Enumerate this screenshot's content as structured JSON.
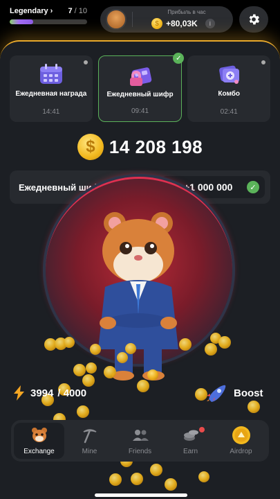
{
  "header": {
    "level_name": "Legendary",
    "level_current": "7",
    "level_total": "/ 10",
    "level_progress": 0.3,
    "profit_label": "Прибыль в час",
    "profit_value": "+80,03K"
  },
  "cards": [
    {
      "title": "Ежедневная награда",
      "time": "14:41",
      "state": "dot"
    },
    {
      "title": "Ежедневный шифр",
      "time": "09:41",
      "state": "done"
    },
    {
      "title": "Комбо",
      "time": "02:41",
      "state": "dot"
    }
  ],
  "balance": "14 208 198",
  "cipher": {
    "label": "Ежедневный шифр",
    "reward": "+1 000 000"
  },
  "energy": {
    "current": "3994",
    "max": "/ 4000"
  },
  "boost_label": "Boost",
  "nav": [
    {
      "label": "Exchange",
      "icon": "hamster-icon"
    },
    {
      "label": "Mine",
      "icon": "pickaxe-icon"
    },
    {
      "label": "Friends",
      "icon": "friends-icon"
    },
    {
      "label": "Earn",
      "icon": "coins-icon"
    },
    {
      "label": "Airdrop",
      "icon": "airdrop-coin-icon"
    }
  ],
  "colors": {
    "accent_gold": "#e9a92b",
    "check_green": "#5bb35a",
    "panel": "#1c1f24",
    "card": "#272a2f"
  }
}
